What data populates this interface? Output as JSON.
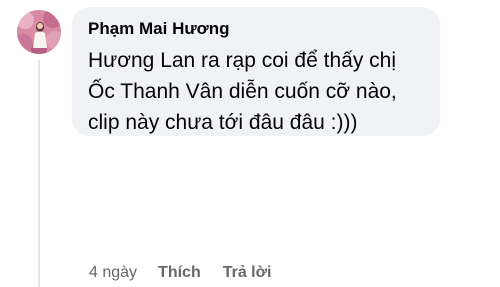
{
  "comment": {
    "author": "Phạm Mai Hương",
    "text_lines": [
      "Hương Lan ra rạp coi để thấy chị",
      "Ốc Thanh Vân diễn cuốn cỡ nào,",
      "clip này chưa tới đâu đâu :)))"
    ],
    "avatar": "profile-photo"
  },
  "actions": {
    "time": "4 ngày",
    "like_label": "Thích",
    "reply_label": "Trả lời"
  },
  "colors": {
    "bubble": "#f0f2f5",
    "text": "#050505",
    "secondary": "#65676b",
    "thread_line": "#e4e6eb"
  }
}
